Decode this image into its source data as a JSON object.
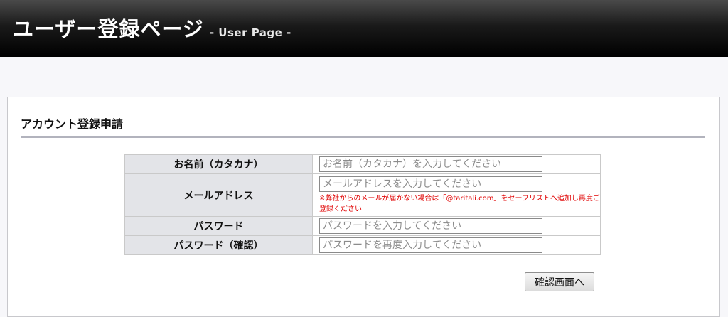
{
  "header": {
    "title": "ユーザー登録ページ",
    "subtitle": "- User Page -"
  },
  "section": {
    "title": "アカウント登録申請"
  },
  "form": {
    "name": {
      "label": "お名前（カタカナ）",
      "placeholder": "お名前（カタカナ）を入力してください",
      "value": ""
    },
    "email": {
      "label": "メールアドレス",
      "placeholder": "メールアドレスを入力してください",
      "value": "",
      "note": "※弊社からのメールが届かない場合は「@taritali.com」をセーフリストへ追加し再度ご登録ください"
    },
    "password": {
      "label": "パスワード",
      "placeholder": "パスワードを入力してください",
      "value": ""
    },
    "password_confirm": {
      "label": "パスワード（確認）",
      "placeholder": "パスワードを再度入力してください",
      "value": ""
    },
    "confirm_button": "確認画面へ"
  },
  "colors": {
    "header_bg": "#000000",
    "label_bg": "#e3e4e8",
    "rule": "#b2b3bd",
    "note_text": "#e00000"
  }
}
